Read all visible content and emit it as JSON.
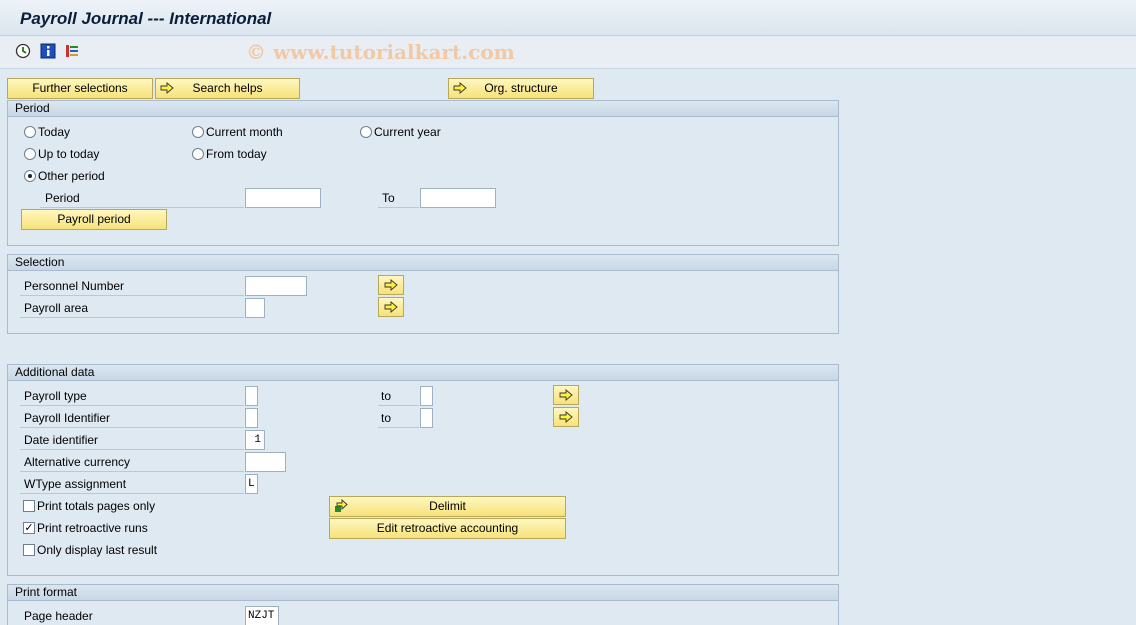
{
  "title": "Payroll Journal --- International",
  "watermark": "© www.tutorialkart.com",
  "toolbar_icons": [
    "execute-icon",
    "info-icon",
    "selection-options-icon"
  ],
  "buttons": {
    "further_selections": "Further selections",
    "search_helps": "Search helps",
    "org_structure": "Org. structure"
  },
  "period": {
    "header": "Period",
    "today": "Today",
    "current_month": "Current month",
    "current_year": "Current year",
    "up_to_today": "Up to today",
    "from_today": "From today",
    "other_period": "Other period",
    "selected": "other_period",
    "period_label": "Period",
    "period_from": "",
    "to_label": "To",
    "period_to": "",
    "payroll_period_button": "Payroll period"
  },
  "selection": {
    "header": "Selection",
    "personnel_number": "Personnel Number",
    "personnel_number_value": "",
    "payroll_area": "Payroll area",
    "payroll_area_value": ""
  },
  "additional": {
    "header": "Additional data",
    "payroll_type": "Payroll type",
    "payroll_type_from": "",
    "payroll_type_to": "",
    "to1": "to",
    "payroll_identifier": "Payroll Identifier",
    "payroll_identifier_from": "",
    "payroll_identifier_to": "",
    "to2": "to",
    "date_identifier": "Date identifier",
    "date_identifier_value": "1",
    "alt_currency": "Alternative currency",
    "alt_currency_value": "",
    "wtype_assignment": "WType assignment",
    "wtype_assignment_value": "L",
    "print_totals": "Print totals pages only",
    "print_totals_checked": false,
    "print_retro": "Print retroactive runs",
    "print_retro_checked": true,
    "only_last": "Only display last result",
    "only_last_checked": false,
    "delimit_button": "Delimit",
    "edit_retro_button": "Edit retroactive accounting"
  },
  "print_format": {
    "header": "Print format",
    "page_header": "Page header",
    "page_header_value": "NZJT"
  },
  "colors": {
    "button_yellow": "#f6e27a",
    "group_border": "#a9bccf",
    "background": "#dfe9f1"
  }
}
